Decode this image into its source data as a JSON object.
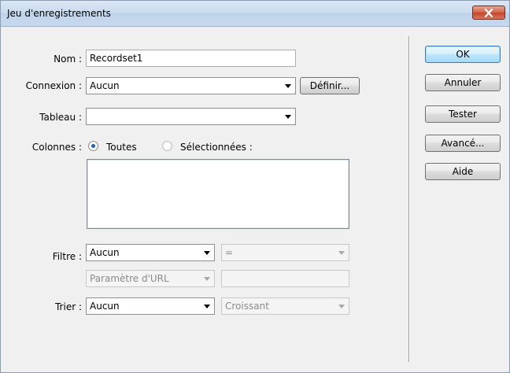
{
  "window": {
    "title": "Jeu d'enregistrements"
  },
  "form": {
    "nom_label": "Nom :",
    "nom_value": "Recordset1",
    "connexion_label": "Connexion :",
    "connexion_value": "Aucun",
    "definir_label": "Définir...",
    "tableau_label": "Tableau :",
    "tableau_value": "",
    "colonnes_label": "Colonnes :",
    "colonnes_toutes": "Toutes",
    "colonnes_selectionnees": "Sélectionnées :",
    "colonnes_selected": "Toutes",
    "filtre_label": "Filtre :",
    "filtre_column": "Aucun",
    "filtre_operator": "=",
    "filtre_source": "Paramètre d'URL",
    "filtre_value": "",
    "trier_label": "Trier :",
    "trier_column": "Aucun",
    "trier_order": "Croissant"
  },
  "buttons": {
    "ok": "OK",
    "annuler": "Annuler",
    "tester": "Tester",
    "avance": "Avancé...",
    "aide": "Aide"
  },
  "colors": {
    "accent": "#3c7fb1",
    "close": "#c4452b"
  }
}
